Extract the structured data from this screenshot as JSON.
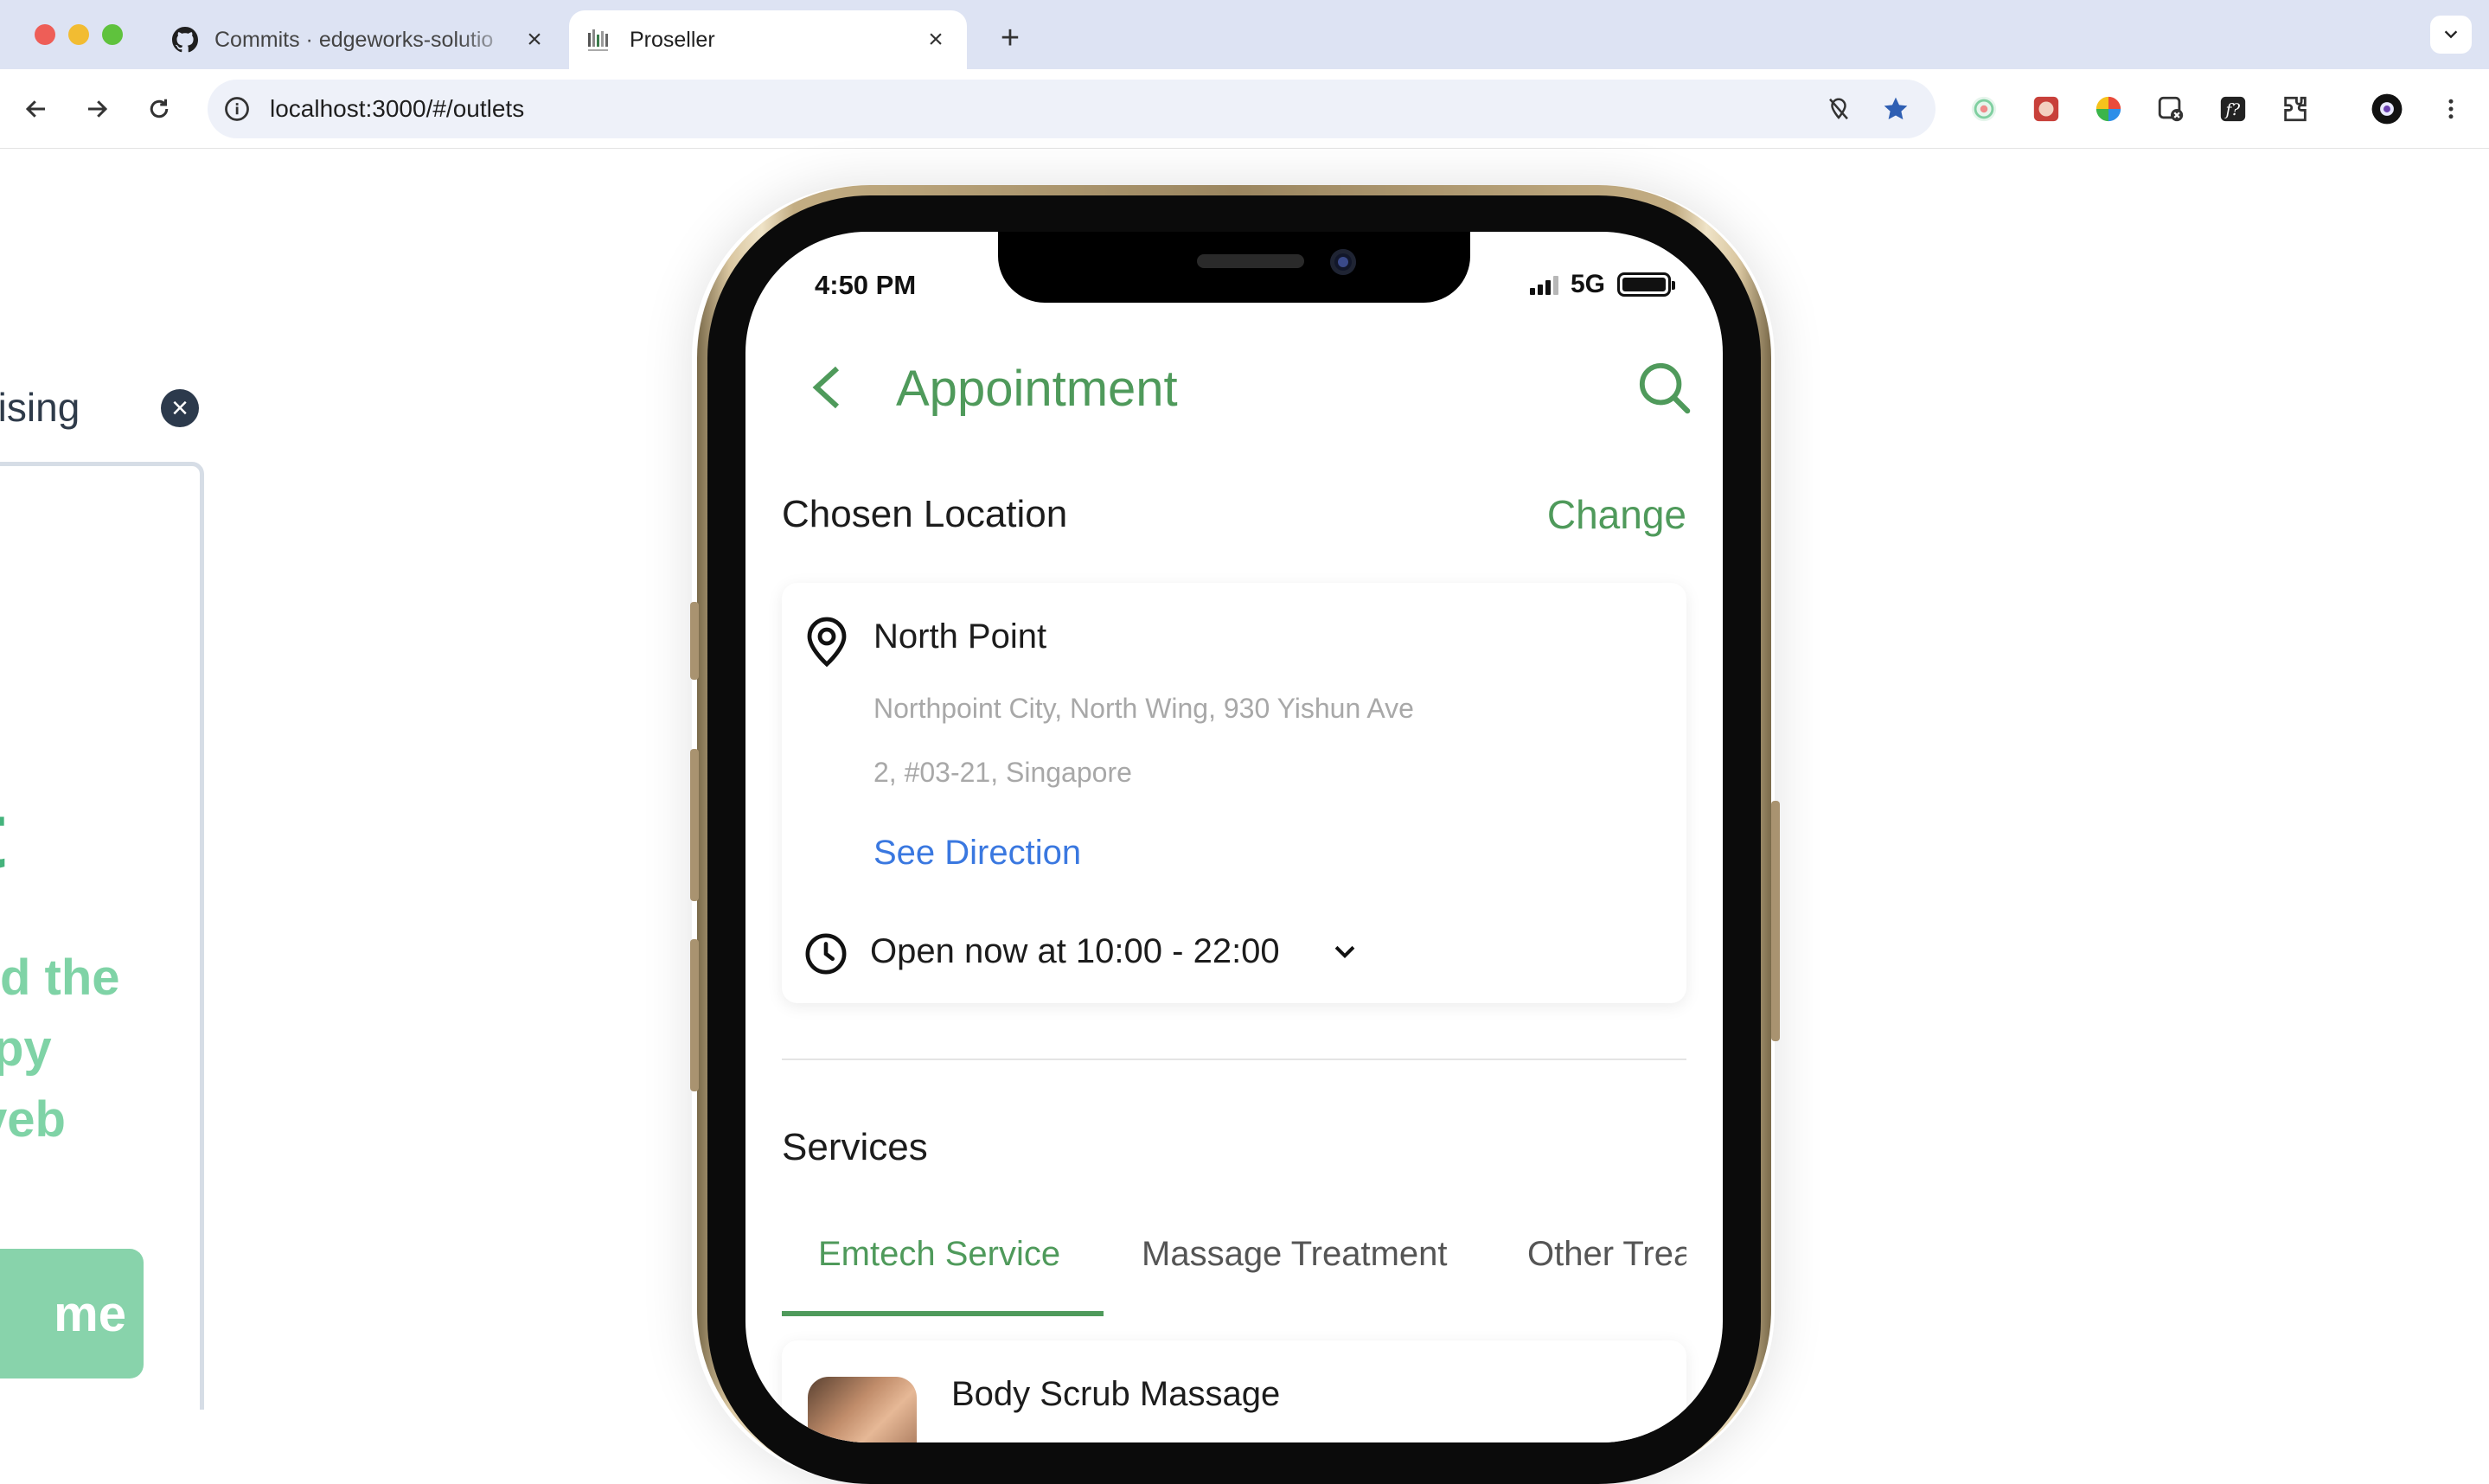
{
  "browser": {
    "tabs": [
      {
        "title": "Commits · edgeworks-solutio",
        "icon": "github-icon",
        "active": false
      },
      {
        "title": "Proseller",
        "icon": "proseller-favicon",
        "active": true
      }
    ],
    "url": "localhost:3000/#/outlets"
  },
  "background_page": {
    "ad_label": "ertising",
    "headline_fragment": "t",
    "description_lines": [
      "d the",
      "py",
      "veb"
    ],
    "button_fragment": "me"
  },
  "status_bar": {
    "time": "4:50 PM",
    "network": "5G"
  },
  "app": {
    "title": "Appointment",
    "chosen_location": {
      "heading": "Chosen Location",
      "change_label": "Change",
      "outlet_name": "North Point",
      "address_line1": "Northpoint City, North Wing, 930 Yishun Ave",
      "address_line2": "2, #03-21, Singapore",
      "direction_label": "See Direction",
      "hours_label": "Open now at 10:00 - 22:00"
    },
    "services": {
      "heading": "Services",
      "tabs": [
        "Emtech Service",
        "Massage Treatment",
        "Other Trea"
      ],
      "active_tab": 0,
      "first_item": "Body Scrub Massage"
    }
  },
  "colors": {
    "brand_green": "#4f9a5b",
    "link_blue": "#3a78e0",
    "address_gray": "#a8a8a8"
  }
}
